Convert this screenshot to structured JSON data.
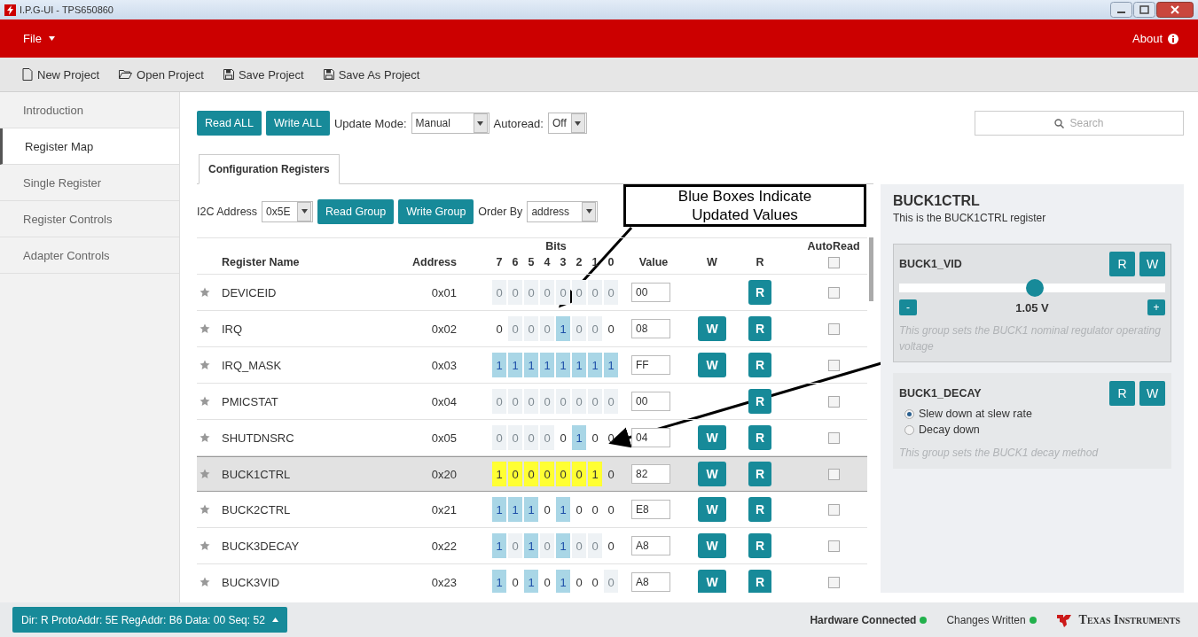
{
  "window": {
    "title": "I.P.G-UI - TPS650860"
  },
  "menu_bar": {
    "file": "File",
    "about": "About"
  },
  "toolbar": [
    {
      "kind": "new",
      "label": "New Project"
    },
    {
      "kind": "open",
      "label": "Open Project"
    },
    {
      "kind": "save",
      "label": "Save Project"
    },
    {
      "kind": "save",
      "label": "Save As Project"
    }
  ],
  "sidebar": {
    "items": [
      {
        "label": "Introduction",
        "selected": false
      },
      {
        "label": "Register Map",
        "selected": true
      },
      {
        "label": "Single Register",
        "selected": false
      },
      {
        "label": "Register Controls",
        "selected": false
      },
      {
        "label": "Adapter Controls",
        "selected": false
      }
    ]
  },
  "actions": {
    "read_all": "Read ALL",
    "write_all": "Write ALL",
    "update_mode_label": "Update Mode:",
    "update_mode": "Manual",
    "autoread_label": "Autoread:",
    "autoread": "Off"
  },
  "search": {
    "placeholder": "Search"
  },
  "tabs": [
    {
      "label": "Configuration Registers",
      "selected": true
    }
  ],
  "group_bar": {
    "i2c_label": "I2C Address",
    "i2c": "0x5E",
    "read_group": "Read Group",
    "write_group": "Write Group",
    "order_label": "Order By",
    "order": "address"
  },
  "table": {
    "columns": {
      "name": "Register Name",
      "address": "Address",
      "bits": "Bits",
      "bit_numbers": [
        "7",
        "6",
        "5",
        "4",
        "3",
        "2",
        "1",
        "0"
      ],
      "value": "Value",
      "w": "W",
      "r": "R",
      "autoread": "AutoRead"
    },
    "autoread_all": false,
    "rows": [
      {
        "name": "DEVICEID",
        "address": "0x01",
        "bits": [
          {
            "value": "0",
            "kind": "dim"
          },
          {
            "value": "0",
            "kind": "dim"
          },
          {
            "value": "0",
            "kind": "dim"
          },
          {
            "value": "0",
            "kind": "dim"
          },
          {
            "value": "0",
            "kind": "dim"
          },
          {
            "value": "0",
            "kind": "dim"
          },
          {
            "value": "0",
            "kind": "dim"
          },
          {
            "value": "0",
            "kind": "dim"
          }
        ],
        "value": "00",
        "read_button": "R",
        "autoread": false,
        "selected": false
      },
      {
        "name": "IRQ",
        "address": "0x02",
        "bits": [
          {
            "value": "0",
            "kind": "plain"
          },
          {
            "value": "0",
            "kind": "dim"
          },
          {
            "value": "0",
            "kind": "dim"
          },
          {
            "value": "0",
            "kind": "dim"
          },
          {
            "value": "1",
            "kind": "updated"
          },
          {
            "value": "0",
            "kind": "dim"
          },
          {
            "value": "0",
            "kind": "dim"
          },
          {
            "value": "0",
            "kind": "plain"
          }
        ],
        "value": "08",
        "write_button": "W",
        "read_button": "R",
        "autoread": false,
        "selected": false
      },
      {
        "name": "IRQ_MASK",
        "address": "0x03",
        "bits": [
          {
            "value": "1",
            "kind": "updated"
          },
          {
            "value": "1",
            "kind": "updated"
          },
          {
            "value": "1",
            "kind": "updated"
          },
          {
            "value": "1",
            "kind": "updated"
          },
          {
            "value": "1",
            "kind": "updated"
          },
          {
            "value": "1",
            "kind": "updated"
          },
          {
            "value": "1",
            "kind": "updated"
          },
          {
            "value": "1",
            "kind": "updated"
          }
        ],
        "value": "FF",
        "write_button": "W",
        "read_button": "R",
        "autoread": false,
        "selected": false
      },
      {
        "name": "PMICSTAT",
        "address": "0x04",
        "bits": [
          {
            "value": "0",
            "kind": "dim"
          },
          {
            "value": "0",
            "kind": "dim"
          },
          {
            "value": "0",
            "kind": "dim"
          },
          {
            "value": "0",
            "kind": "dim"
          },
          {
            "value": "0",
            "kind": "dim"
          },
          {
            "value": "0",
            "kind": "dim"
          },
          {
            "value": "0",
            "kind": "dim"
          },
          {
            "value": "0",
            "kind": "dim"
          }
        ],
        "value": "00",
        "read_button": "R",
        "autoread": false,
        "selected": false
      },
      {
        "name": "SHUTDNSRC",
        "address": "0x05",
        "bits": [
          {
            "value": "0",
            "kind": "dim"
          },
          {
            "value": "0",
            "kind": "dim"
          },
          {
            "value": "0",
            "kind": "dim"
          },
          {
            "value": "0",
            "kind": "dim"
          },
          {
            "value": "0",
            "kind": "plain"
          },
          {
            "value": "1",
            "kind": "updated"
          },
          {
            "value": "0",
            "kind": "plain"
          },
          {
            "value": "0",
            "kind": "plain"
          }
        ],
        "value": "04",
        "write_button": "W",
        "read_button": "R",
        "autoread": false,
        "selected": false
      },
      {
        "name": "BUCK1CTRL",
        "address": "0x20",
        "bits": [
          {
            "value": "1",
            "kind": "changed"
          },
          {
            "value": "0",
            "kind": "changed"
          },
          {
            "value": "0",
            "kind": "changed"
          },
          {
            "value": "0",
            "kind": "changed"
          },
          {
            "value": "0",
            "kind": "changed"
          },
          {
            "value": "0",
            "kind": "changed"
          },
          {
            "value": "1",
            "kind": "changed"
          },
          {
            "value": "0",
            "kind": "plain"
          }
        ],
        "value": "82",
        "write_button": "W",
        "read_button": "R",
        "autoread": false,
        "selected": true
      },
      {
        "name": "BUCK2CTRL",
        "address": "0x21",
        "bits": [
          {
            "value": "1",
            "kind": "updated"
          },
          {
            "value": "1",
            "kind": "updated"
          },
          {
            "value": "1",
            "kind": "updated"
          },
          {
            "value": "0",
            "kind": "plain"
          },
          {
            "value": "1",
            "kind": "updated"
          },
          {
            "value": "0",
            "kind": "plain"
          },
          {
            "value": "0",
            "kind": "plain"
          },
          {
            "value": "0",
            "kind": "plain"
          }
        ],
        "value": "E8",
        "write_button": "W",
        "read_button": "R",
        "autoread": false,
        "selected": false
      },
      {
        "name": "BUCK3DECAY",
        "address": "0x22",
        "bits": [
          {
            "value": "1",
            "kind": "updated"
          },
          {
            "value": "0",
            "kind": "dim"
          },
          {
            "value": "1",
            "kind": "updated"
          },
          {
            "value": "0",
            "kind": "dim"
          },
          {
            "value": "1",
            "kind": "updated"
          },
          {
            "value": "0",
            "kind": "dim"
          },
          {
            "value": "0",
            "kind": "dim"
          },
          {
            "value": "0",
            "kind": "plain"
          }
        ],
        "value": "A8",
        "write_button": "W",
        "read_button": "R",
        "autoread": false,
        "selected": false
      },
      {
        "name": "BUCK3VID",
        "address": "0x23",
        "bits": [
          {
            "value": "1",
            "kind": "updated"
          },
          {
            "value": "0",
            "kind": "plain"
          },
          {
            "value": "1",
            "kind": "updated"
          },
          {
            "value": "0",
            "kind": "plain"
          },
          {
            "value": "1",
            "kind": "updated"
          },
          {
            "value": "0",
            "kind": "plain"
          },
          {
            "value": "0",
            "kind": "plain"
          },
          {
            "value": "0",
            "kind": "dim"
          }
        ],
        "value": "A8",
        "write_button": "W",
        "read_button": "R",
        "autoread": false,
        "selected": false
      }
    ]
  },
  "annotation": {
    "text": "Blue Boxes Indicate Updated Values"
  },
  "detail": {
    "title": "BUCK1CTRL",
    "description": "This is the BUCK1CTRL register",
    "groups": [
      {
        "kind": "slider",
        "name": "BUCK1_VID",
        "read": "R",
        "write": "W",
        "highlighted": true,
        "level": 0.51,
        "minus": "-",
        "reading": "1.05 V",
        "plus": "+",
        "note": "This group sets the BUCK1 nominal regulator operating voltage"
      },
      {
        "kind": "radio",
        "name": "BUCK1_DECAY",
        "read": "R",
        "write": "W",
        "highlighted": false,
        "options": [
          {
            "label": "Slew down at slew rate",
            "selected": true
          },
          {
            "label": "Decay down",
            "selected": false
          }
        ],
        "note": "This group sets the BUCK1 decay method"
      }
    ]
  },
  "status_bar": {
    "transaction": "Dir: R ProtoAddr: 5E RegAddr: B6 Data: 00 Seq: 52",
    "indicators": [
      {
        "label": "Hardware Connected",
        "emphasis": true,
        "color": "#22b14c"
      },
      {
        "label": "Changes Written",
        "emphasis": false,
        "color": "#22b14c"
      }
    ],
    "brand": "Texas Instruments"
  }
}
